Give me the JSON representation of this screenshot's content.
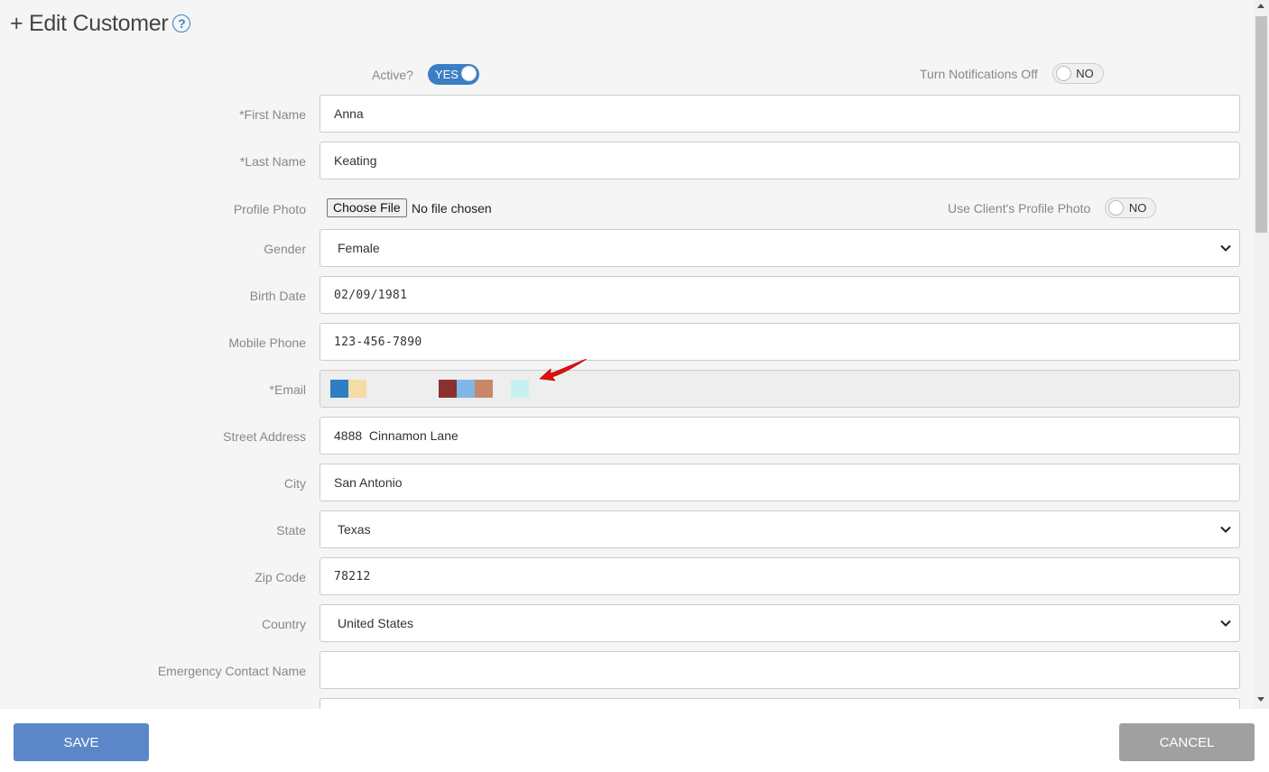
{
  "header": {
    "title": "+ Edit Customer",
    "help_icon": "?"
  },
  "toggles": {
    "active": {
      "label": "Active?",
      "value": "YES"
    },
    "notifications": {
      "label": "Turn Notifications Off",
      "value": "NO"
    },
    "client_photo": {
      "label": "Use Client's Profile Photo",
      "value": "NO"
    }
  },
  "form": {
    "first_name": {
      "label": "*First Name",
      "value": "Anna"
    },
    "last_name": {
      "label": "*Last Name",
      "value": "Keating"
    },
    "profile_photo": {
      "label": "Profile Photo",
      "button": "Choose File",
      "status": "No file chosen"
    },
    "gender": {
      "label": "Gender",
      "value": "Female"
    },
    "birth_date": {
      "label": "Birth Date",
      "value": "02/09/1981"
    },
    "mobile_phone": {
      "label": "Mobile Phone",
      "value": "123-456-7890"
    },
    "email": {
      "label": "*Email",
      "swatch_colors": [
        "#2e7fc2",
        "#f5dca4",
        "#8b3030",
        "#7fb8e8",
        "#c9876a",
        "#c6f1f0"
      ]
    },
    "street_address": {
      "label": "Street Address",
      "value": "4888  Cinnamon Lane"
    },
    "city": {
      "label": "City",
      "value": "San Antonio"
    },
    "state": {
      "label": "State",
      "value": "Texas"
    },
    "zip": {
      "label": "Zip Code",
      "value": "78212"
    },
    "country": {
      "label": "Country",
      "value": "United States"
    },
    "emergency_name": {
      "label": "Emergency Contact Name",
      "value": ""
    }
  },
  "footer": {
    "save_label": "SAVE",
    "cancel_label": "CANCEL"
  },
  "colors": {
    "accent": "#3a7fc4",
    "save": "#5b87c9",
    "cancel": "#a0a0a0",
    "arrow": "#e01010"
  }
}
